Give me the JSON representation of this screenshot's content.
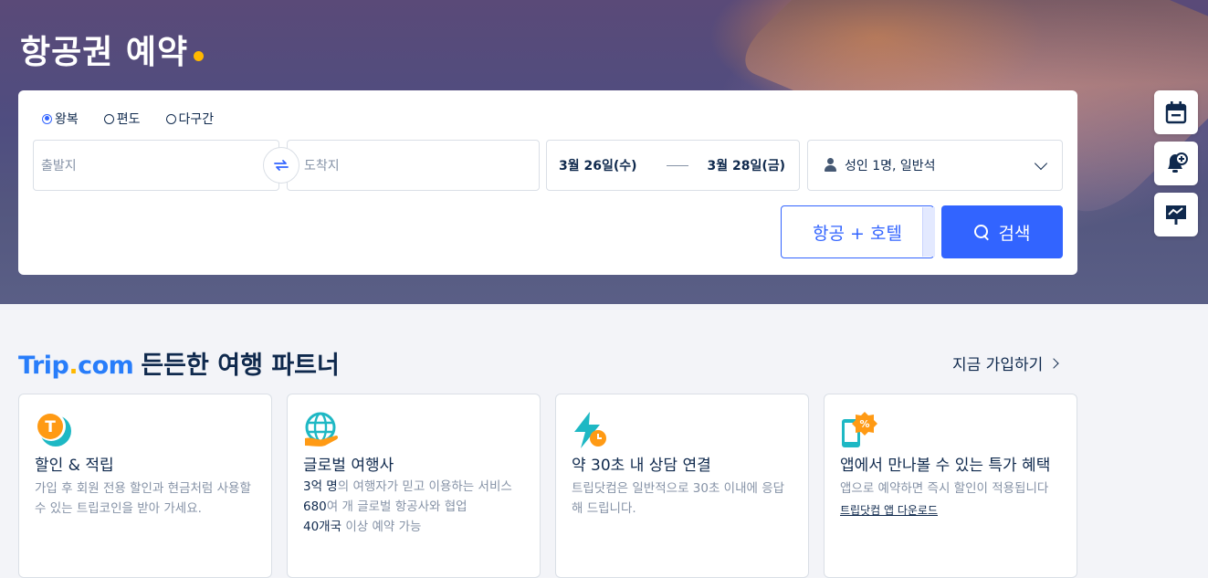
{
  "hero": {
    "title": "항공권 예약"
  },
  "search": {
    "trip_types": [
      {
        "label": "왕복",
        "selected": true
      },
      {
        "label": "편도",
        "selected": false
      },
      {
        "label": "다구간",
        "selected": false
      }
    ],
    "from_placeholder": "출발지",
    "to_placeholder": "도착지",
    "depart_date": "3월 26일(수)",
    "return_date": "3월 28일(금)",
    "passengers": "성인 1명, 일반석",
    "flight_hotel_label": "항공 + 호텔",
    "search_label": "검색"
  },
  "side_buttons": [
    {
      "icon": "calendar-icon"
    },
    {
      "icon": "price-alert-bell-icon"
    },
    {
      "icon": "price-trend-icon"
    }
  ],
  "partner": {
    "brand_trip": "Trip",
    "brand_dot": ".",
    "brand_com": "com",
    "heading": "든든한 여행 파트너",
    "signup_label": "지금 가입하기"
  },
  "cards": [
    {
      "icon": "trip-coin-icon",
      "title": "할인 & 적립",
      "desc": "가입 후 회원 전용 할인과 현금처럼 사용할 수 있는 트립코인을 받아 가세요."
    },
    {
      "icon": "globe-hand-icon",
      "title": "글로벌 여행사",
      "lines": [
        {
          "highlight": "3억 명",
          "rest": "의 여행자가 믿고 이용하는 서비스"
        },
        {
          "highlight": "680",
          "rest": "여 개 글로벌 항공사와 협업"
        },
        {
          "highlight": "40개국",
          "rest": " 이상 예약 가능"
        }
      ]
    },
    {
      "icon": "lightning-clock-icon",
      "title": "약 30초 내 상담 연결",
      "desc": "트립닷컴은 일반적으로 30초 이내에 응답해 드립니다."
    },
    {
      "icon": "phone-discount-icon",
      "title": "앱에서 만나볼 수 있는 특가 혜택",
      "desc": "앱으로 예약하면 즉시 할인이 적용됩니다",
      "link": "트립닷컴 앱 다운로드"
    }
  ],
  "colors": {
    "accent": "#3264ff",
    "brand_blue": "#287dfa",
    "brand_yellow": "#ffb800",
    "text_dark": "#0f294d",
    "text_muted": "#8592a6"
  }
}
